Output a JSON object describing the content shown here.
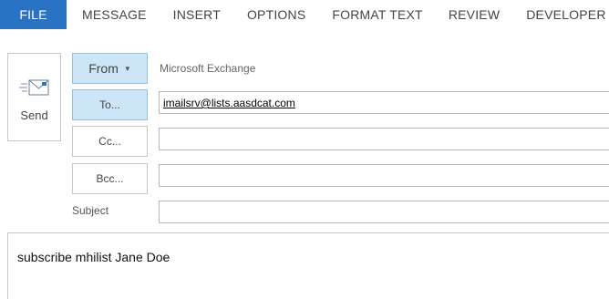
{
  "ribbon": {
    "tabs": [
      {
        "label": "FILE"
      },
      {
        "label": "MESSAGE"
      },
      {
        "label": "INSERT"
      },
      {
        "label": "OPTIONS"
      },
      {
        "label": "FORMAT TEXT"
      },
      {
        "label": "REVIEW"
      },
      {
        "label": "DEVELOPER"
      }
    ]
  },
  "colors": {
    "file_tab": "#2a72c4",
    "active_button": "#cde6f7"
  },
  "send": {
    "label": "Send",
    "icon": "envelope-send-icon"
  },
  "from": {
    "label": "From",
    "account": "Microsoft Exchange"
  },
  "to": {
    "label": "To...",
    "value": "imailsrv@lists.aasdcat.com"
  },
  "cc": {
    "label": "Cc...",
    "value": ""
  },
  "bcc": {
    "label": "Bcc...",
    "value": ""
  },
  "subject": {
    "label": "Subject",
    "value": ""
  },
  "body": {
    "text": "subscribe mhilist Jane Doe"
  }
}
